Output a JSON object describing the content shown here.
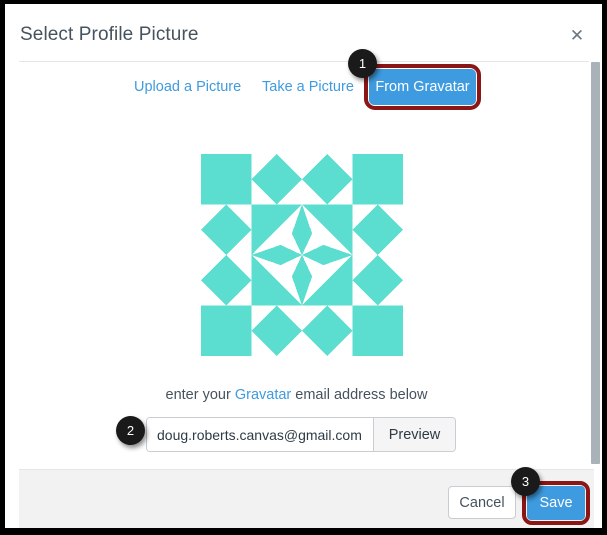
{
  "dialog": {
    "title": "Select Profile Picture",
    "close_icon": "close-icon",
    "close_glyph": "✕"
  },
  "tabs": [
    {
      "id": "upload",
      "label": "Upload a Picture",
      "selected": false
    },
    {
      "id": "take",
      "label": "Take a Picture",
      "selected": false
    },
    {
      "id": "gravatar",
      "label": "From Gravatar",
      "selected": true
    }
  ],
  "gravatar": {
    "image_name": "gravatar-identicon-preview",
    "pattern_color": "#5bddcf",
    "background_color": "#ffffff"
  },
  "helper": {
    "prefix": "enter your ",
    "link": "Gravatar",
    "suffix": " email address below"
  },
  "email_field": {
    "value": "doug.roberts.canvas@gmail.com",
    "placeholder": "enter your Gravatar email address"
  },
  "preview": {
    "label": "Preview"
  },
  "footer": {
    "cancel_label": "Cancel",
    "save_label": "Save"
  },
  "callouts": [
    {
      "number": "1",
      "target": "From Gravatar tab"
    },
    {
      "number": "2",
      "target": "Gravatar email address field"
    },
    {
      "number": "3",
      "target": "Save button"
    }
  ],
  "colors": {
    "accent_blue": "#3e9bdf",
    "annotation_red": "#8c1515",
    "badge_black": "#1a1a1a",
    "text_dark": "#46535e",
    "footer_gray": "#f2f2f2",
    "gravatar_teal": "#5bddcf"
  }
}
